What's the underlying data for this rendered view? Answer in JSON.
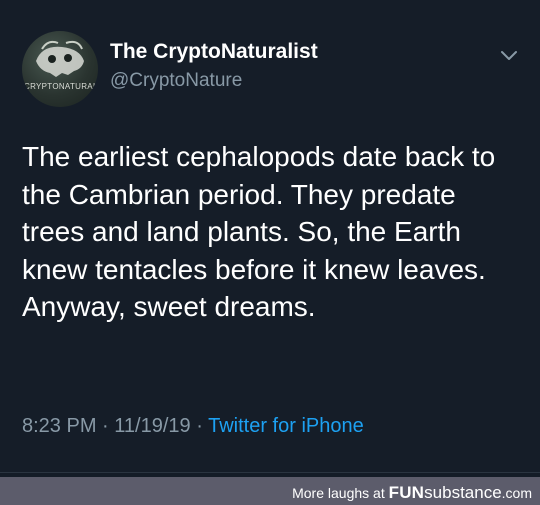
{
  "tweet": {
    "display_name": "The CryptoNaturalist",
    "handle": "@CryptoNature",
    "avatar_text": "CRYPTONATURALIST",
    "text_lines": [
      "The earliest cephalopods date back to",
      "the Cambrian period. They predate",
      "trees and land plants. So, the Earth",
      "knew tentacles before it knew leaves.",
      "Anyway, sweet dreams."
    ],
    "time": "8:23 PM",
    "date": "11/19/19",
    "separator": "·",
    "source": "Twitter for iPhone",
    "menu_icon": "chevron-down-icon"
  },
  "footer": {
    "prefix": "More laughs at",
    "brand_bold": "FUN",
    "brand_rest": "substance",
    "brand_tld": ".com"
  },
  "colors": {
    "background": "#151d28",
    "text": "#ffffff",
    "muted": "#8899a6",
    "link": "#1da1f2",
    "footer_bg": "#5c5c6b"
  }
}
